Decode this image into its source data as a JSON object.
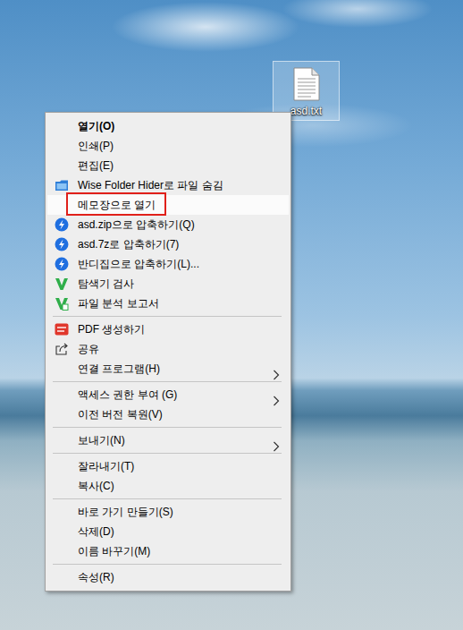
{
  "desktop": {
    "icons": [
      {
        "label": "asd.txt",
        "selected": true
      }
    ]
  },
  "context_menu": {
    "items": [
      {
        "kind": "item",
        "label": "열기(O)",
        "default": true,
        "highlighted": false,
        "outlined": false,
        "submenu": false
      },
      {
        "kind": "item",
        "label": "인쇄(P)",
        "default": false,
        "highlighted": false,
        "outlined": false,
        "submenu": false
      },
      {
        "kind": "item",
        "label": "편집(E)",
        "default": false,
        "highlighted": false,
        "outlined": false,
        "submenu": false
      },
      {
        "kind": "item",
        "label": "Wise Folder Hider로 파일 숨김",
        "default": false,
        "highlighted": false,
        "outlined": false,
        "submenu": false
      },
      {
        "kind": "item",
        "label": "메모장으로 열기",
        "default": false,
        "highlighted": true,
        "outlined": true,
        "submenu": false
      },
      {
        "kind": "item",
        "label": "asd.zip으로 압축하기(Q)",
        "default": false,
        "highlighted": false,
        "outlined": false,
        "submenu": false
      },
      {
        "kind": "item",
        "label": "asd.7z로 압축하기(7)",
        "default": false,
        "highlighted": false,
        "outlined": false,
        "submenu": false
      },
      {
        "kind": "item",
        "label": "반디집으로 압축하기(L)...",
        "default": false,
        "highlighted": false,
        "outlined": false,
        "submenu": false
      },
      {
        "kind": "item",
        "label": "탐색기 검사",
        "default": false,
        "highlighted": false,
        "outlined": false,
        "submenu": false
      },
      {
        "kind": "item",
        "label": "파일 분석 보고서",
        "default": false,
        "highlighted": false,
        "outlined": false,
        "submenu": false
      },
      {
        "kind": "separator"
      },
      {
        "kind": "item",
        "label": "PDF 생성하기",
        "default": false,
        "highlighted": false,
        "outlined": false,
        "submenu": false
      },
      {
        "kind": "item",
        "label": "공유",
        "default": false,
        "highlighted": false,
        "outlined": false,
        "submenu": false
      },
      {
        "kind": "item",
        "label": "연결 프로그램(H)",
        "default": false,
        "highlighted": false,
        "outlined": false,
        "submenu": true
      },
      {
        "kind": "separator"
      },
      {
        "kind": "item",
        "label": "액세스 권한 부여 (G)",
        "default": false,
        "highlighted": false,
        "outlined": false,
        "submenu": true
      },
      {
        "kind": "item",
        "label": "이전 버전 복원(V)",
        "default": false,
        "highlighted": false,
        "outlined": false,
        "submenu": false
      },
      {
        "kind": "separator"
      },
      {
        "kind": "item",
        "label": "보내기(N)",
        "default": false,
        "highlighted": false,
        "outlined": false,
        "submenu": true
      },
      {
        "kind": "separator"
      },
      {
        "kind": "item",
        "label": "잘라내기(T)",
        "default": false,
        "highlighted": false,
        "outlined": false,
        "submenu": false
      },
      {
        "kind": "item",
        "label": "복사(C)",
        "default": false,
        "highlighted": false,
        "outlined": false,
        "submenu": false
      },
      {
        "kind": "separator"
      },
      {
        "kind": "item",
        "label": "바로 가기 만들기(S)",
        "default": false,
        "highlighted": false,
        "outlined": false,
        "submenu": false
      },
      {
        "kind": "item",
        "label": "삭제(D)",
        "default": false,
        "highlighted": false,
        "outlined": false,
        "submenu": false
      },
      {
        "kind": "item",
        "label": "이름 바꾸기(M)",
        "default": false,
        "highlighted": false,
        "outlined": false,
        "submenu": false
      },
      {
        "kind": "separator"
      },
      {
        "kind": "item",
        "label": "속성(R)",
        "default": false,
        "highlighted": false,
        "outlined": false,
        "submenu": false
      }
    ]
  }
}
